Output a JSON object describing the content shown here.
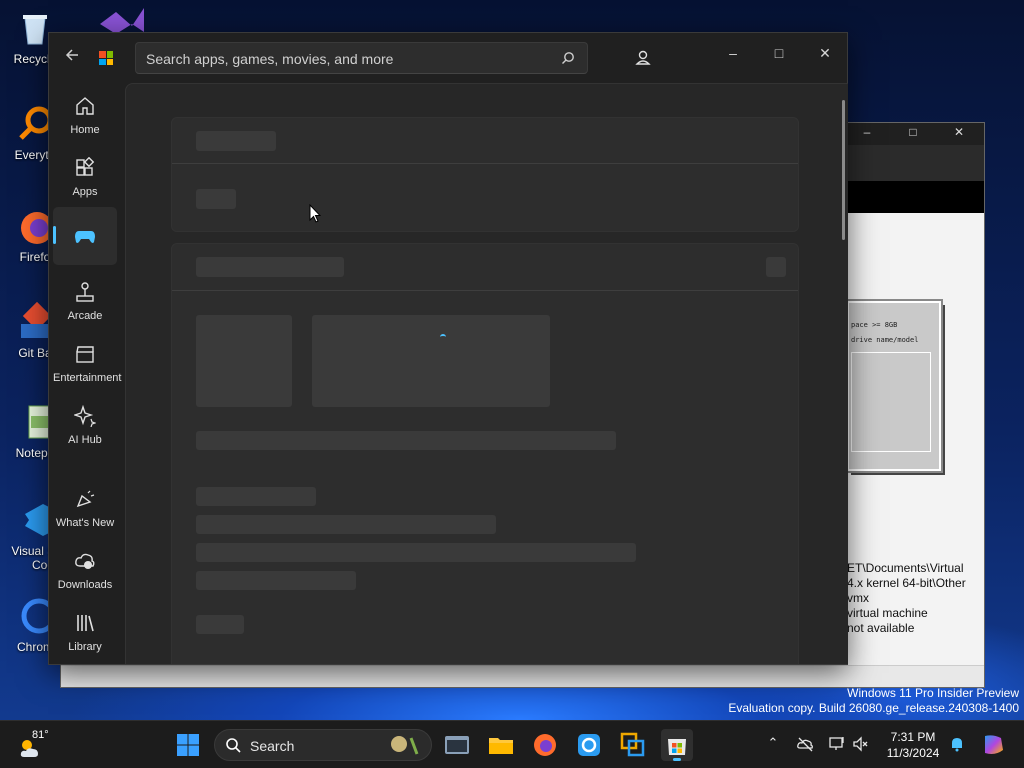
{
  "desktop": {
    "icons": [
      {
        "label": "Recycle",
        "icon": "recycle-bin-icon"
      },
      {
        "label": "Everyth",
        "icon": "everything-search-icon"
      },
      {
        "label": "Firefo",
        "icon": "firefox-icon"
      },
      {
        "label": "Git Ba",
        "icon": "git-bash-icon"
      },
      {
        "label": "Notepa",
        "icon": "notepad-icon"
      },
      {
        "label": "Visual St",
        "label2": "Cod",
        "icon": "vscode-icon"
      },
      {
        "label": "Chrom",
        "icon": "chrome-icon"
      }
    ]
  },
  "vm_window": {
    "screen_lines": [
      "pace >= 8GB",
      "drive name/model"
    ],
    "info_lines": [
      "ET\\Documents\\Virtual",
      "4.x kernel 64-bit\\Other",
      "vmx",
      " virtual machine",
      "not available"
    ]
  },
  "store": {
    "search_placeholder": "Search apps, games, movies, and more",
    "nav": [
      {
        "label": "Home",
        "icon": "home-icon"
      },
      {
        "label": "Apps",
        "icon": "apps-icon"
      },
      {
        "label": "",
        "icon": "gamepad-icon",
        "active": true
      },
      {
        "label": "Arcade",
        "icon": "joystick-icon"
      },
      {
        "label": "Entertainment",
        "icon": "clapperboard-icon"
      },
      {
        "label": "AI Hub",
        "icon": "sparkle-icon"
      },
      {
        "label": "What's New",
        "icon": "megaphone-icon"
      },
      {
        "label": "Downloads",
        "icon": "cloud-download-icon"
      },
      {
        "label": "Library",
        "icon": "library-icon"
      }
    ]
  },
  "watermark": {
    "line1": "Windows 11 Pro Insider Preview",
    "line2": "Evaluation copy. Build 26080.ge_release.240308-1400"
  },
  "taskbar": {
    "weather_temp": "81°",
    "search_label": "Search",
    "clock_time": "7:31 PM",
    "clock_date": "11/3/2024"
  },
  "colors": {
    "accent": "#4cc2ff",
    "store_bg": "#202020",
    "content_bg": "#272727",
    "skeleton": "#3a3a3a"
  }
}
